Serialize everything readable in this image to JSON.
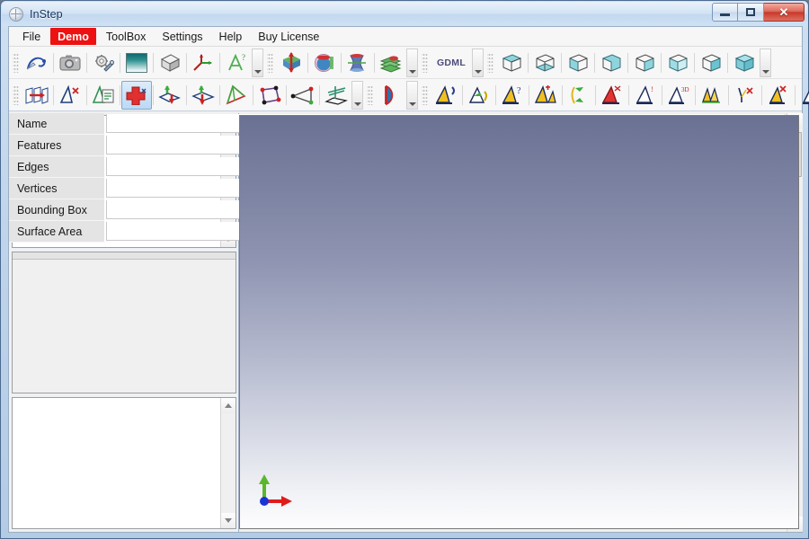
{
  "window": {
    "title": "InStep",
    "icon": "sphere-globe-icon",
    "controls": {
      "minimize": "minimize-icon",
      "maximize": "maximize-icon",
      "close": "✕"
    }
  },
  "menu": {
    "items": [
      {
        "label": "File",
        "accent": false
      },
      {
        "label": "Demo",
        "accent": true
      },
      {
        "label": "ToolBox",
        "accent": false
      },
      {
        "label": "Settings",
        "accent": false
      },
      {
        "label": "Help",
        "accent": false
      },
      {
        "label": "Buy License",
        "accent": false
      }
    ],
    "accent_color": "#ee1111"
  },
  "toolbar_top": {
    "groups": [
      {
        "name": "file-group",
        "buttons": [
          {
            "icon": "spline-curve-icon",
            "active": false
          },
          {
            "icon": "camera-icon",
            "active": false
          },
          {
            "icon": "gear-wrench-icon",
            "active": false
          },
          {
            "icon": "gradient-swatch-icon",
            "active": false
          },
          {
            "icon": "solid-cube-icon",
            "active": false
          },
          {
            "icon": "axes-triad-icon",
            "active": false
          },
          {
            "icon": "axes-query-icon",
            "active": false
          }
        ],
        "overflow": true
      },
      {
        "name": "solids-group",
        "buttons": [
          {
            "icon": "boolean-union-icon",
            "active": false
          },
          {
            "icon": "sphere-clip-icon",
            "active": false
          },
          {
            "icon": "hyperboloid-icon",
            "active": false
          },
          {
            "icon": "stacked-slabs-icon",
            "active": false
          }
        ],
        "overflow": true
      },
      {
        "name": "gdml-group",
        "label": "GDML",
        "buttons": [],
        "overflow": true
      },
      {
        "name": "box-group",
        "buttons": [
          {
            "icon": "box-wire-top-icon",
            "active": false
          },
          {
            "icon": "box-wire-bottom-icon",
            "active": false
          },
          {
            "icon": "box-shaded-front-icon",
            "active": false
          },
          {
            "icon": "box-shaded-back-icon",
            "active": false
          },
          {
            "icon": "box-shaded-left-icon",
            "active": false
          },
          {
            "icon": "box-shaded-right-icon",
            "active": false
          },
          {
            "icon": "box-wire-side-icon",
            "active": false
          },
          {
            "icon": "box-solid-icon",
            "active": false
          }
        ],
        "overflow": true
      }
    ]
  },
  "toolbar_bottom": {
    "groups": [
      {
        "name": "sheet-group",
        "buttons": [
          {
            "icon": "sheet-offset-icon",
            "active": false
          },
          {
            "icon": "face-extract-icon",
            "active": false
          },
          {
            "icon": "face-report-icon",
            "active": false
          },
          {
            "icon": "add-feature-icon",
            "active": true
          },
          {
            "icon": "extrude-down-icon",
            "active": false
          },
          {
            "icon": "extrude-up-icon",
            "active": false
          }
        ],
        "overflow": false
      },
      {
        "name": "polygon-group",
        "buttons": [
          {
            "icon": "triangle-mesh-icon",
            "active": false
          },
          {
            "icon": "quad-vertices-icon",
            "active": false
          },
          {
            "icon": "triangle-edges-icon",
            "active": false
          },
          {
            "icon": "plane-normal-icon",
            "active": false
          }
        ],
        "overflow": true
      },
      {
        "name": "arc-group",
        "buttons": [
          {
            "icon": "half-disc-icon",
            "active": false
          }
        ],
        "overflow": true
      },
      {
        "name": "prism-group",
        "buttons": [
          {
            "icon": "prism-rotate-icon",
            "active": false
          },
          {
            "icon": "prism-split-icon",
            "active": false
          },
          {
            "icon": "prism-query-icon",
            "active": false
          },
          {
            "icon": "prism-add-icon",
            "active": false
          },
          {
            "icon": "prism-trim-icon",
            "active": false
          },
          {
            "icon": "prism-red-icon",
            "active": false
          },
          {
            "icon": "prism-outline-icon",
            "active": false
          },
          {
            "icon": "prism-3d-icon",
            "active": false
          },
          {
            "icon": "prism-stack-icon",
            "active": false
          },
          {
            "icon": "prism-vertex-icon",
            "active": false
          },
          {
            "icon": "prism-fill-icon",
            "active": false
          },
          {
            "icon": "prism-point-icon",
            "active": false
          },
          {
            "icon": "prism-revolve-icon",
            "active": false
          }
        ],
        "overflow": true
      }
    ]
  },
  "left_dock": {
    "tree_panel": {
      "name": "model-tree",
      "items": []
    },
    "properties": {
      "rows": [
        {
          "label": "Name",
          "value": ""
        },
        {
          "label": "Features",
          "value": ""
        },
        {
          "label": "Edges",
          "value": ""
        },
        {
          "label": "Vertices",
          "value": ""
        },
        {
          "label": "Bounding Box",
          "value": ""
        },
        {
          "label": "Surface Area",
          "value": ""
        }
      ]
    },
    "log_panel": {
      "name": "message-log",
      "content": ""
    }
  },
  "viewport": {
    "name": "3d-viewport",
    "background_top": "#6a7193",
    "background_bottom": "#fdfdfe",
    "axis_gizmo": {
      "x_axis_color": "#e01b1b",
      "y_axis_color": "#5ab72a",
      "origin_color": "#1a33d8"
    }
  }
}
